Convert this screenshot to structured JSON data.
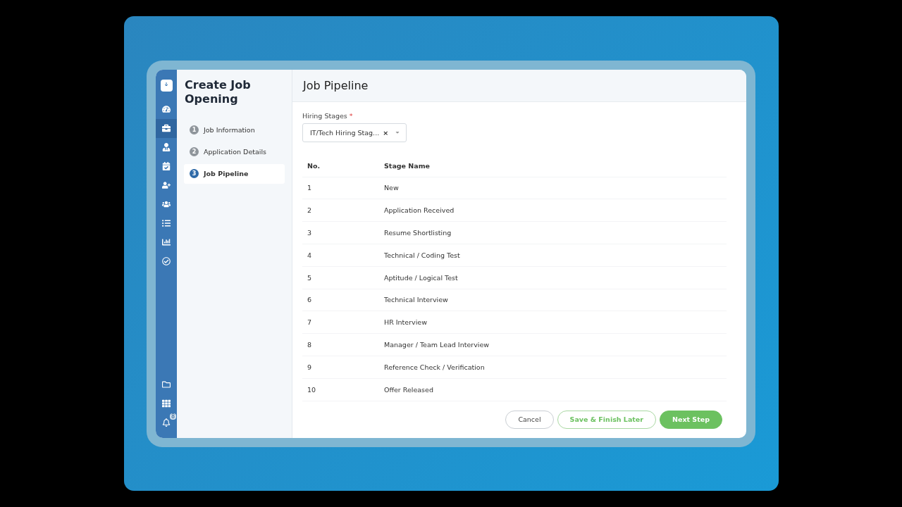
{
  "nav": {
    "items": [
      {
        "selected": false
      },
      {
        "selected": true
      },
      {
        "selected": false
      },
      {
        "selected": false
      },
      {
        "selected": false
      },
      {
        "selected": false
      },
      {
        "selected": false
      },
      {
        "selected": false
      },
      {
        "selected": false
      }
    ],
    "notification_badge": "8"
  },
  "wizard": {
    "title": "Create Job Opening",
    "steps": [
      {
        "number": "1",
        "label": "Job Information",
        "selected": false
      },
      {
        "number": "2",
        "label": "Application Details",
        "selected": false
      },
      {
        "number": "3",
        "label": "Job Pipeline",
        "selected": true
      }
    ]
  },
  "page": {
    "title": "Job Pipeline",
    "field": {
      "label": "Hiring Stages",
      "required_mark": "*",
      "value": "IT/Tech Hiring Stag...",
      "clear": "×"
    },
    "table": {
      "columns": [
        "No.",
        "Stage Name"
      ],
      "rows": [
        [
          "1",
          "New"
        ],
        [
          "2",
          "Application Received"
        ],
        [
          "3",
          "Resume Shortlisting"
        ],
        [
          "4",
          "Technical / Coding Test"
        ],
        [
          "5",
          "Aptitude / Logical Test"
        ],
        [
          "6",
          "Technical Interview"
        ],
        [
          "7",
          "HR Interview"
        ],
        [
          "8",
          "Manager / Team Lead Interview"
        ],
        [
          "9",
          "Reference Check / Verification"
        ],
        [
          "10",
          "Offer Released"
        ]
      ]
    },
    "buttons": [
      {
        "label": "Cancel",
        "kind": "plain"
      },
      {
        "label": "Save & Finish Later",
        "kind": "outline"
      },
      {
        "label": "Next Step",
        "kind": "primary"
      }
    ]
  }
}
